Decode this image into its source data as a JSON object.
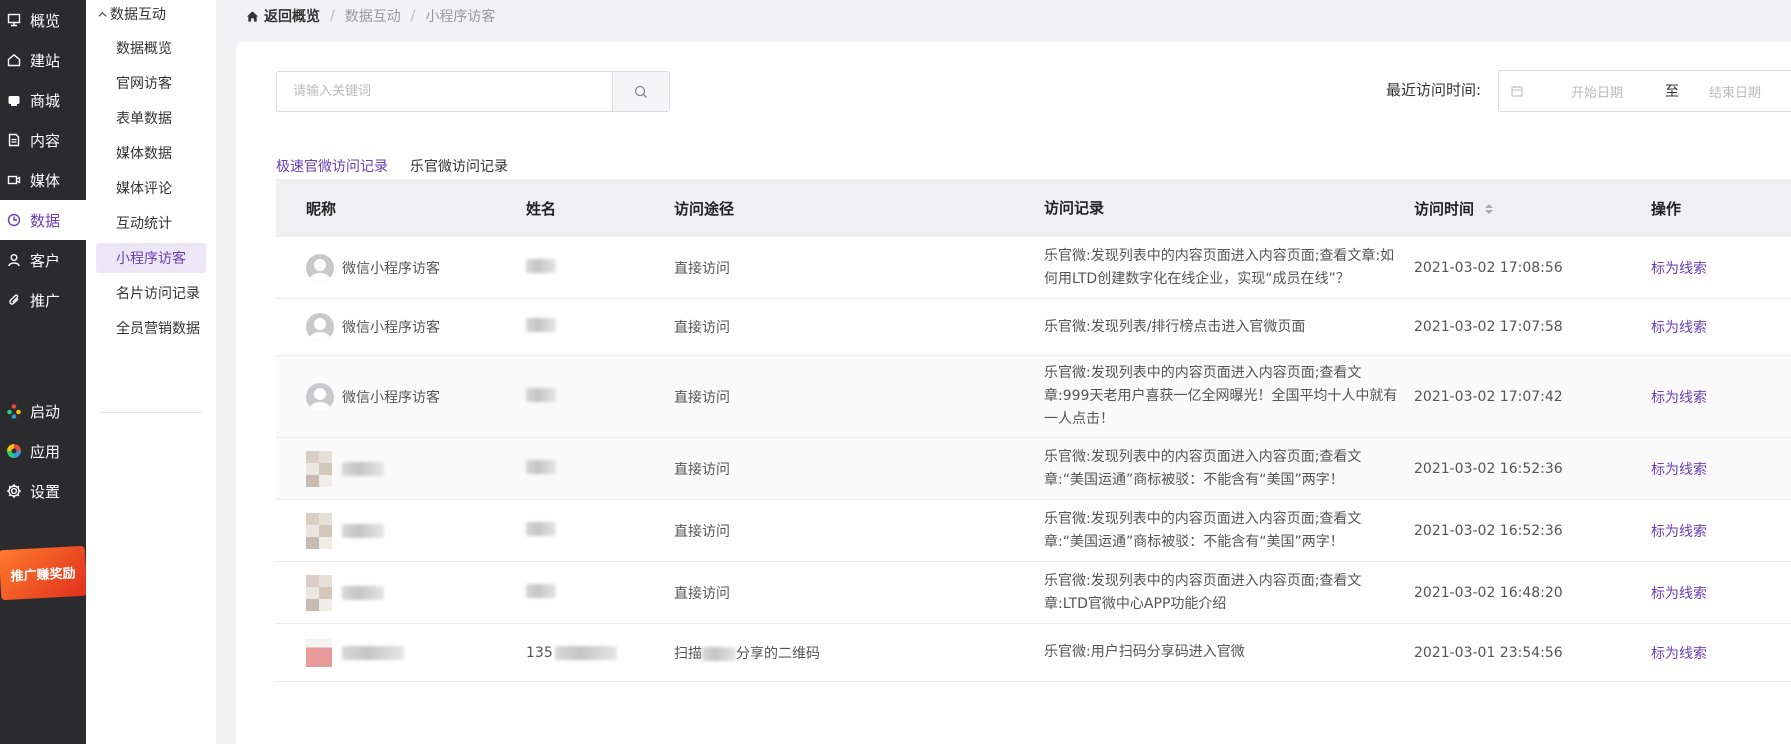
{
  "nav": {
    "items": [
      {
        "label": "概览",
        "icon": "overview-icon",
        "active": false
      },
      {
        "label": "建站",
        "icon": "home-icon",
        "active": false
      },
      {
        "label": "商城",
        "icon": "shop-icon",
        "active": false
      },
      {
        "label": "内容",
        "icon": "document-icon",
        "active": false
      },
      {
        "label": "媒体",
        "icon": "video-icon",
        "active": false
      },
      {
        "label": "数据",
        "icon": "chart-clock-icon",
        "active": true
      },
      {
        "label": "客户",
        "icon": "user-icon",
        "active": false
      },
      {
        "label": "推广",
        "icon": "paperclip-icon",
        "active": false
      }
    ],
    "bottom_items": [
      {
        "label": "启动",
        "icon": "launch-dots-icon"
      },
      {
        "label": "应用",
        "icon": "apps-color-icon"
      },
      {
        "label": "设置",
        "icon": "gear-icon"
      }
    ],
    "promo_label": "推广赚奖励",
    "active_color": "#6a3fb5"
  },
  "subnav": {
    "header": "数据互动",
    "items": [
      {
        "label": "数据概览",
        "active": false
      },
      {
        "label": "官网访客",
        "active": false
      },
      {
        "label": "表单数据",
        "active": false
      },
      {
        "label": "媒体数据",
        "active": false
      },
      {
        "label": "媒体评论",
        "active": false
      },
      {
        "label": "互动统计",
        "active": false
      },
      {
        "label": "小程序访客",
        "active": true
      },
      {
        "label": "名片访问记录",
        "active": false
      },
      {
        "label": "全员营销数据",
        "active": false
      }
    ]
  },
  "breadcrumb": {
    "home": "返回概览",
    "items": [
      "数据互动",
      "小程序访客"
    ],
    "separator": "/"
  },
  "search": {
    "placeholder": "请输入关键词",
    "value": ""
  },
  "date_filter": {
    "label": "最近访问时间:",
    "start_placeholder": "开始日期",
    "separator": "至",
    "end_placeholder": "结束日期"
  },
  "tabs": [
    {
      "label": "极速官微访问记录",
      "active": true
    },
    {
      "label": "乐官微访问记录",
      "active": false
    }
  ],
  "table": {
    "headers": [
      "昵称",
      "姓名",
      "访问途径",
      "访问记录",
      "访问时间",
      "操作"
    ],
    "rows": [
      {
        "nickname": "微信小程序访客",
        "avatar": "default",
        "name_visible": "",
        "channel": "直接访问",
        "record": "乐官微:发现列表中的内容页面进入内容页面;查看文章:如何用LTD创建数字化在线企业，实现“成员在线”？",
        "time": "2021-03-02 17:08:56",
        "action": "标为线索"
      },
      {
        "nickname": "微信小程序访客",
        "avatar": "default",
        "name_visible": "",
        "channel": "直接访问",
        "record": "乐官微:发现列表/排行榜点击进入官微页面",
        "time": "2021-03-02 17:07:58",
        "action": "标为线索"
      },
      {
        "nickname": "微信小程序访客",
        "avatar": "default",
        "name_visible": "",
        "channel": "直接访问",
        "record": "乐官微:发现列表中的内容页面进入内容页面;查看文章:999天老用户喜获一亿全网曝光！全国平均十人中就有一人点击！",
        "time": "2021-03-02 17:07:42",
        "action": "标为线索"
      },
      {
        "nickname": "",
        "avatar": "mosaic",
        "name_visible": "",
        "channel": "直接访问",
        "record": "乐官微:发现列表中的内容页面进入内容页面;查看文章:“美国运通”商标被驳：不能含有“美国”两字！",
        "time": "2021-03-02 16:52:36",
        "action": "标为线索"
      },
      {
        "nickname": "",
        "avatar": "mosaic",
        "name_visible": "",
        "channel": "直接访问",
        "record": "乐官微:发现列表中的内容页面进入内容页面;查看文章:“美国运通”商标被驳：不能含有“美国”两字！",
        "time": "2021-03-02 16:52:36",
        "action": "标为线索"
      },
      {
        "nickname": "",
        "avatar": "mosaic",
        "name_visible": "",
        "channel": "直接访问",
        "record": "乐官微:发现列表中的内容页面进入内容页面;查看文章:LTD官微中心APP功能介绍",
        "time": "2021-03-02 16:48:20",
        "action": "标为线索"
      },
      {
        "nickname": "",
        "avatar": "mosaic-pink",
        "name_visible": "135",
        "channel_prefix": "扫描",
        "channel_suffix": "分享的二维码",
        "channel": "",
        "record": "乐官微:用户扫码分享码进入官微",
        "time": "2021-03-01 23:54:56",
        "action": "标为线索"
      }
    ]
  }
}
